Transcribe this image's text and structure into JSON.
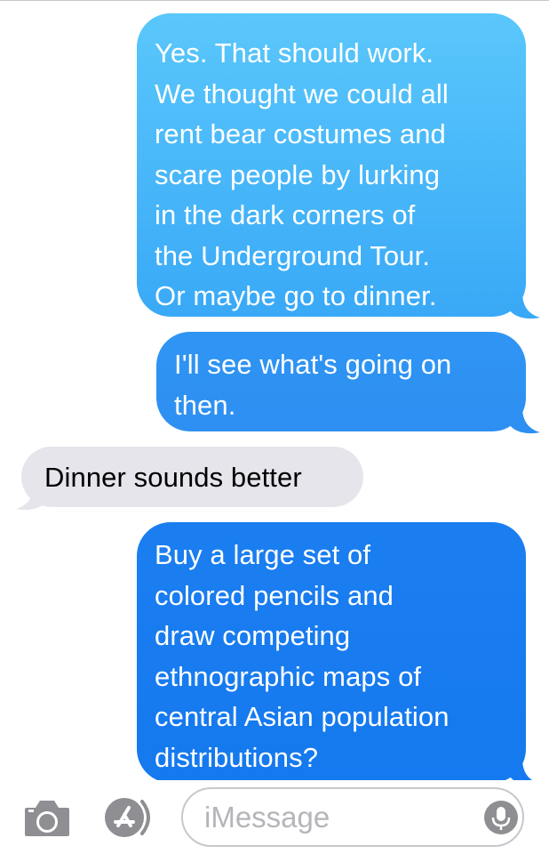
{
  "messages": [
    {
      "direction": "outgoing",
      "lines": [
        "Yes. That should work.",
        "We thought we could all",
        "rent bear costumes and",
        "scare people  by lurking",
        "in the dark corners of",
        "the Underground Tour.",
        "Or maybe go to dinner."
      ]
    },
    {
      "direction": "outgoing",
      "lines": [
        "I'll see what's going on",
        "then."
      ]
    },
    {
      "direction": "incoming",
      "lines": [
        "Dinner sounds better"
      ]
    },
    {
      "direction": "outgoing",
      "lines": [
        "Buy a large set of",
        "colored pencils and",
        "draw competing",
        "ethnographic maps of",
        "central Asian population",
        "distributions?"
      ]
    }
  ],
  "input_bar": {
    "placeholder": "iMessage",
    "camera_icon": "camera-icon",
    "apps_icon": "app-store-icon",
    "mic_icon": "microphone-icon"
  },
  "colors": {
    "outgoing_top": "#5ac7fb",
    "outgoing_bottom": "#1579ef",
    "incoming": "#e6e5eb",
    "icon_gray": "#8e8e93"
  }
}
